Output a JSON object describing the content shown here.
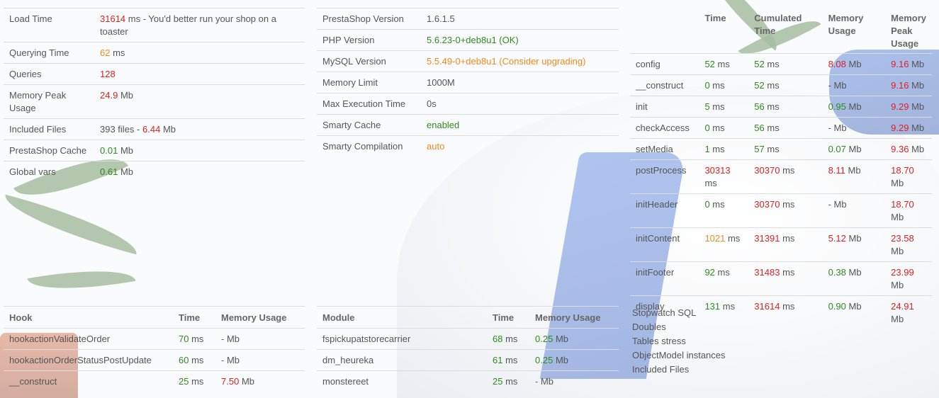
{
  "summary": [
    {
      "label": "Load Time",
      "value": "31614",
      "value_color": "r",
      "unit": "ms - You'd better run your shop on a toaster"
    },
    {
      "label": "Querying Time",
      "value": "62",
      "value_color": "o",
      "unit": "ms"
    },
    {
      "label": "Queries",
      "value": "128",
      "value_color": "r",
      "unit": ""
    },
    {
      "label": "Memory Peak Usage",
      "value": "24.9",
      "value_color": "r",
      "unit": "Mb"
    },
    {
      "label": "Included Files",
      "prefix": "393 files -",
      "value": "6.44",
      "value_color": "r",
      "unit": "Mb"
    },
    {
      "label": "PrestaShop Cache",
      "value": "0.01",
      "value_color": "g",
      "unit": "Mb"
    },
    {
      "label": "Global vars",
      "value": "0.61",
      "value_color": "g",
      "unit": "Mb"
    }
  ],
  "versions": [
    {
      "label": "PrestaShop Version",
      "value": "1.6.1.5",
      "value_color": "u"
    },
    {
      "label": "PHP Version",
      "value": "5.6.23-0+deb8u1 (OK)",
      "value_color": "g"
    },
    {
      "label": "MySQL Version",
      "value": "5.5.49-0+deb8u1 (Consider upgrading)",
      "value_color": "o"
    },
    {
      "label": "Memory Limit",
      "value": "1000M",
      "value_color": "u"
    },
    {
      "label": "Max Execution Time",
      "value": "0s",
      "value_color": "u"
    },
    {
      "label": "Smarty Cache",
      "value": "enabled",
      "value_color": "g"
    },
    {
      "label": "Smarty Compilation",
      "value": "auto",
      "value_color": "o"
    }
  ],
  "timings": {
    "headers": [
      "",
      "Time",
      "Cumulated Time",
      "Memory Usage",
      "Memory Peak Usage"
    ],
    "rows": [
      {
        "name": "config",
        "time": "52",
        "tc": "g",
        "cum": "52",
        "cc": "g",
        "mem": "8.08",
        "mc": "r",
        "peak": "9.16",
        "pc": "r"
      },
      {
        "name": "__construct",
        "time": "0",
        "tc": "g",
        "cum": "52",
        "cc": "g",
        "mem": "-",
        "mc": "u",
        "peak": "9.16",
        "pc": "r"
      },
      {
        "name": "init",
        "time": "5",
        "tc": "g",
        "cum": "56",
        "cc": "g",
        "mem": "0.95",
        "mc": "g",
        "peak": "9.29",
        "pc": "r"
      },
      {
        "name": "checkAccess",
        "time": "0",
        "tc": "g",
        "cum": "56",
        "cc": "g",
        "mem": "-",
        "mc": "u",
        "peak": "9.29",
        "pc": "r"
      },
      {
        "name": "setMedia",
        "time": "1",
        "tc": "g",
        "cum": "57",
        "cc": "g",
        "mem": "0.07",
        "mc": "g",
        "peak": "9.36",
        "pc": "r"
      },
      {
        "name": "postProcess",
        "time": "30313",
        "tc": "r",
        "cum": "30370",
        "cc": "r",
        "mem": "8.11",
        "mc": "r",
        "peak": "18.70",
        "pc": "r"
      },
      {
        "name": "initHeader",
        "time": "0",
        "tc": "g",
        "cum": "30370",
        "cc": "r",
        "mem": "-",
        "mc": "u",
        "peak": "18.70",
        "pc": "r"
      },
      {
        "name": "initContent",
        "time": "1021",
        "tc": "o",
        "cum": "31391",
        "cc": "r",
        "mem": "5.12",
        "mc": "r",
        "peak": "23.58",
        "pc": "r"
      },
      {
        "name": "initFooter",
        "time": "92",
        "tc": "g",
        "cum": "31483",
        "cc": "r",
        "mem": "0.38",
        "mc": "g",
        "peak": "23.99",
        "pc": "r"
      },
      {
        "name": "display",
        "time": "131",
        "tc": "g",
        "cum": "31614",
        "cc": "r",
        "mem": "0.90",
        "mc": "g",
        "peak": "24.91",
        "pc": "r"
      }
    ],
    "ms_unit": "ms",
    "mb_unit": "Mb"
  },
  "hooks": {
    "headers": [
      "Hook",
      "Time",
      "Memory Usage"
    ],
    "rows": [
      {
        "name": "hookactionValidateOrder",
        "time": "70",
        "tc": "g",
        "mem": "-",
        "mc": "g"
      },
      {
        "name": "hookactionOrderStatusPostUpdate",
        "time": "60",
        "tc": "g",
        "mem": "-",
        "mc": "g"
      },
      {
        "name": "__construct",
        "time": "25",
        "tc": "g",
        "mem": "7.50",
        "mc": "r"
      }
    ]
  },
  "modules": {
    "headers": [
      "Module",
      "Time",
      "Memory Usage"
    ],
    "rows": [
      {
        "name": "fspickupatstorecarrier",
        "time": "68",
        "tc": "g",
        "mem": "0.25",
        "mc": "g"
      },
      {
        "name": "dm_heureka",
        "time": "61",
        "tc": "g",
        "mem": "0.25",
        "mc": "g"
      },
      {
        "name": "monstereet",
        "time": "25",
        "tc": "g",
        "mem": "-",
        "mc": "g"
      }
    ]
  },
  "links": [
    "Stopwatch SQL",
    "Doubles",
    "Tables stress",
    "ObjectModel instances",
    "Included Files"
  ]
}
